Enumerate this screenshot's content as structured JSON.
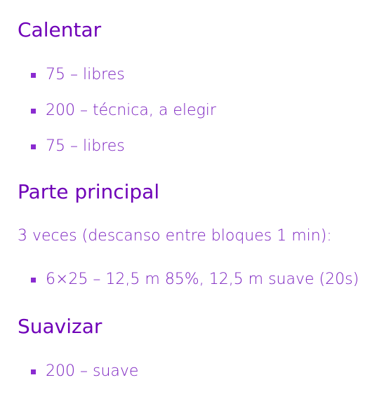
{
  "sections": [
    {
      "title": "Calentar",
      "items": [
        "75 – libres",
        "200 – técnica, a elegir",
        "75 – libres"
      ]
    },
    {
      "title": "Parte principal",
      "intro": "3 veces (descanso entre bloques 1 min):",
      "items": [
        "6×25 – 12,5 m 85%, 12,5 m suave (20s)"
      ]
    },
    {
      "title": "Suavizar",
      "items": [
        "200 – suave"
      ]
    }
  ],
  "colors": {
    "heading": "#6f00b8",
    "text": "#7a1fbf",
    "bullet": "#8a2bd0"
  }
}
